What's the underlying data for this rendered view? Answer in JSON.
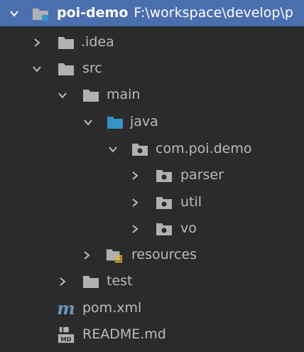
{
  "project": {
    "name": "poi-demo",
    "path": "F:\\workspace\\develop\\p",
    "icon": "module-folder-icon",
    "expanded": true
  },
  "items": [
    {
      "label": ".idea",
      "icon": "folder-icon",
      "expanded": false
    },
    {
      "label": "src",
      "icon": "folder-icon",
      "expanded": true
    },
    {
      "label": "main",
      "icon": "folder-icon",
      "expanded": true
    },
    {
      "label": "java",
      "icon": "source-root-folder-icon",
      "expanded": true
    },
    {
      "label": "com.poi.demo",
      "icon": "package-icon",
      "expanded": true
    },
    {
      "label": "parser",
      "icon": "package-icon",
      "expanded": false
    },
    {
      "label": "util",
      "icon": "package-icon",
      "expanded": false
    },
    {
      "label": "vo",
      "icon": "package-icon",
      "expanded": false
    },
    {
      "label": "resources",
      "icon": "resources-folder-icon",
      "expanded": false
    },
    {
      "label": "test",
      "icon": "folder-icon",
      "expanded": false
    },
    {
      "label": "pom.xml",
      "icon": "maven-icon"
    },
    {
      "label": "README.md",
      "icon": "markdown-icon"
    }
  ],
  "colors": {
    "background": "#2b2b2b",
    "selection": "#4b6eaf",
    "text": "#bbbbbb",
    "folder": "#afb1b3",
    "source_root": "#3592c4",
    "resources_bars": "#e8b73b",
    "maven": "#6897bb"
  }
}
